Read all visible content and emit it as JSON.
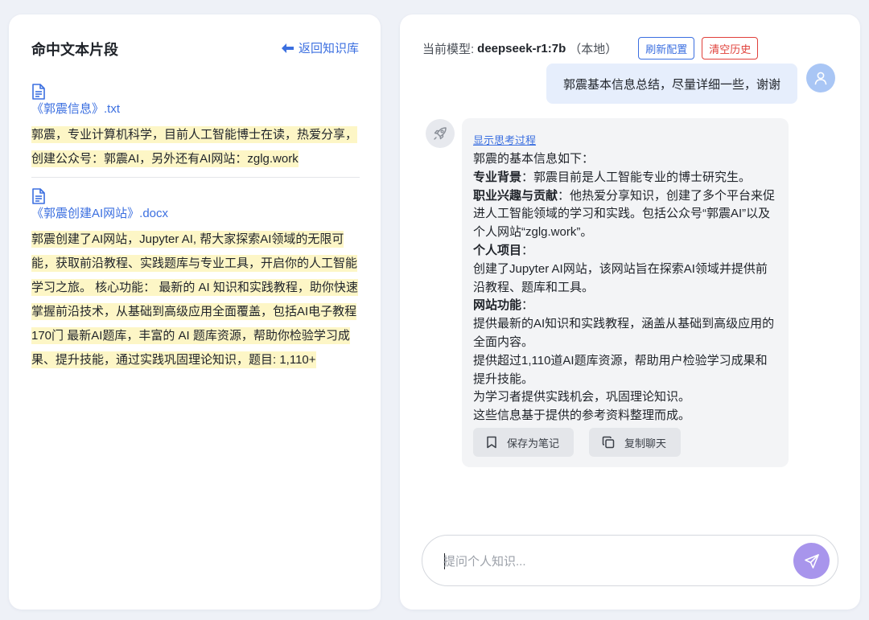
{
  "left_panel": {
    "title": "命中文本片段",
    "back_label": "返回知识库",
    "back_icon": "arrow-left-icon",
    "fragments": [
      {
        "icon": "document-icon",
        "name": "《郭震信息》.txt",
        "text": "郭震，专业计算机科学，目前人工智能博士在读，热爱分享，创建公众号：郭震AI，另外还有AI网站：zglg.work"
      },
      {
        "icon": "document-icon",
        "name": "《郭震创建AI网站》.docx",
        "text": "郭震创建了AI网站，Jupyter AI, 帮大家探索AI领域的无限可能，获取前沿教程、实践题库与专业工具，开启你的人工智能学习之旅。 核心功能： 最新的 AI 知识和实践教程，助你快速掌握前沿技术，从基础到高级应用全面覆盖，包括AI电子教程170门 最新AI题库，丰富的 AI 题库资源，帮助你检验学习成果、提升技能，通过实践巩固理论知识，题目: 1,110+"
      }
    ],
    "highlight_color": "#fdf6c6"
  },
  "chat": {
    "model_label": "当前模型:",
    "model_name": "deepseek-r1:7b",
    "model_local": "（本地）",
    "refresh_label": "刷新配置",
    "clear_label": "清空历史",
    "user_message": "郭震基本信息总结，尽量详细一些，谢谢",
    "user_avatar_icon": "user-icon",
    "bot_avatar_icon": "rocket-icon",
    "show_thinking_label": "显示思考过程",
    "answer": {
      "intro": "郭震的基本信息如下：",
      "bg_title": "专业背景",
      "bg_text": "：郭震目前是人工智能专业的博士研究生。",
      "career_title": "职业兴趣与贡献",
      "career_text": "：他热爱分享知识，创建了多个平台来促进人工智能领域的学习和实践。包括公众号“郭震AI”以及个人网站“zglg.work”。",
      "projects_title": "个人项目",
      "projects_colon": "：",
      "projects_text": "创建了Jupyter AI网站，该网站旨在探索AI领域并提供前沿教程、题库和工具。",
      "site_title": "网站功能",
      "site_colon": "：",
      "site_item1": "提供最新的AI知识和实践教程，涵盖从基础到高级应用的全面内容。",
      "site_item2": "提供超过1,110道AI题库资源，帮助用户检验学习成果和提升技能。",
      "site_item3": "为学习者提供实践机会，巩固理论知识。",
      "conclusion": "这些信息基于提供的参考资料整理而成。"
    },
    "save_note_label": "保存为笔记",
    "save_note_icon": "bookmark-icon",
    "copy_label": "复制聊天",
    "copy_icon": "copy-icon",
    "input_placeholder": "提问个人知识...",
    "input_value": "",
    "send_icon": "send-icon",
    "accent_color": "#3b6fe0",
    "danger_color": "#e0403a",
    "send_color": "#a895ec"
  }
}
